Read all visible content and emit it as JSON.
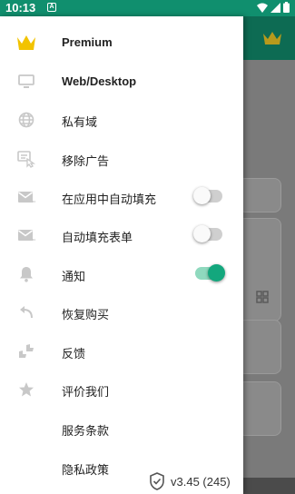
{
  "status_bar": {
    "time": "10:13",
    "notification_letter": "A"
  },
  "colors": {
    "brand": "#108f6e",
    "switch_on": "#13a77d",
    "crown": "#f2c300"
  },
  "drawer": {
    "items": [
      {
        "label": "Premium",
        "icon": "crown-icon"
      },
      {
        "label": "Web/Desktop",
        "icon": "monitor-icon"
      },
      {
        "label": "私有域",
        "icon": "globe-icon"
      },
      {
        "label": "移除广告",
        "icon": "remove-ads-icon"
      },
      {
        "label": "在应用中自动填充",
        "icon": "mail-icon",
        "toggle": false
      },
      {
        "label": "自动填充表单",
        "icon": "mail-icon",
        "toggle": false
      },
      {
        "label": "通知",
        "icon": "bell-icon",
        "toggle": true
      },
      {
        "label": "恢复购买",
        "icon": "undo-icon"
      },
      {
        "label": "反馈",
        "icon": "thumbs-icon"
      },
      {
        "label": "评价我们",
        "icon": "star-icon"
      },
      {
        "label": "服务条款"
      },
      {
        "label": "隐私政策"
      }
    ],
    "footer": {
      "version": "v3.45 (245)"
    }
  }
}
